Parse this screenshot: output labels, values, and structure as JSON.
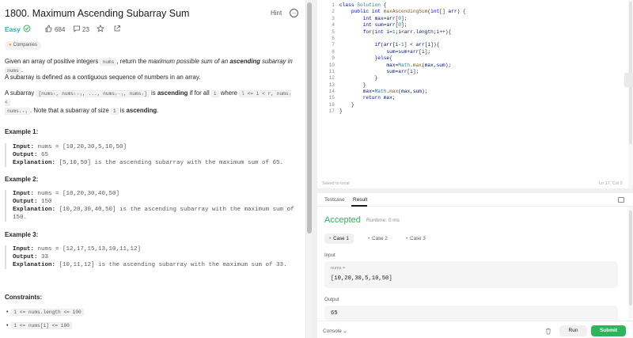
{
  "problem": {
    "title": "1800. Maximum Ascending Subarray Sum",
    "hint_label": "Hint",
    "difficulty": "Easy",
    "likes": "684",
    "comments": "23",
    "companies_label": "Companies",
    "desc1_a": "Given an array of positive integers ",
    "desc1_code": "nums",
    "desc1_b": ", return the ",
    "desc1_it": "maximum possible sum of an ",
    "desc1_bold": "ascending",
    "desc1_it2": " subarray in ",
    "desc1_code2": "nums",
    "desc1_c": ".",
    "desc2": "A subarray is defined as a contiguous sequence of numbers in an array.",
    "desc3_a": "A subarray ",
    "desc3_code1": "[numsₗ, numsₗ₊₁, ..., numsᵣ₋₁, numsᵣ]",
    "desc3_b": " is ",
    "desc3_bold": "ascending",
    "desc3_c": " if for all ",
    "desc3_code2": "i",
    "desc3_d": " where ",
    "desc3_code3": "l <= i < r, numsᵢ  <",
    "desc3_code4": "numsᵢ₊₁",
    "desc3_e": ". Note that a subarray of size ",
    "desc3_code5": "1",
    "desc3_f": " is ",
    "desc3_bold2": "ascending",
    "desc3_g": ".",
    "examples": [
      {
        "title": "Example 1:",
        "input_label": "Input:",
        "input": " nums = [10,20,30,5,10,50]",
        "output_label": "Output:",
        "output": " 65",
        "expl_label": "Explanation:",
        "expl": " [5,10,50] is the ascending subarray with the maximum sum of 65.",
        "expl2": ""
      },
      {
        "title": "Example 2:",
        "input_label": "Input:",
        "input": " nums = [10,20,30,40,50]",
        "output_label": "Output:",
        "output": " 150",
        "expl_label": "Explanation:",
        "expl": " [10,20,30,40,50] is the ascending subarray with the maximum sum of",
        "expl2": "150."
      },
      {
        "title": "Example 3:",
        "input_label": "Input:",
        "input": " nums = [12,17,15,13,10,11,12]",
        "output_label": "Output:",
        "output": " 33",
        "expl_label": "Explanation:",
        "expl": " [10,11,12] is the ascending subarray with the maximum sum of 33.",
        "expl2": ""
      }
    ],
    "constraints_title": "Constraints:",
    "constraints": [
      "1 <= nums.length <= 100",
      "1 <= nums[i] <= 100"
    ]
  },
  "editor": {
    "line_numbers": [
      "1",
      "2",
      "3",
      "4",
      "5",
      "6",
      "7",
      "8",
      "9",
      "10",
      "11",
      "12",
      "13",
      "14",
      "15",
      "16",
      "17"
    ],
    "status_left": "Saved to local",
    "status_right": "Ln 17, Col 2"
  },
  "result": {
    "tabs": [
      "Testcase",
      "Result"
    ],
    "active_tab": "Result",
    "verdict": "Accepted",
    "runtime": "Runtime: 0 ms",
    "cases": [
      "Case 1",
      "Case 2",
      "Case 3"
    ],
    "input_label": "Input",
    "input_sub": "nums =",
    "input_value": "[10,20,30,5,10,50]",
    "output_label": "Output",
    "output_value": "65",
    "console_label": "Console",
    "run_label": "Run",
    "submit_label": "Submit"
  },
  "colors": {
    "accent_green": "#2db55d",
    "easy_teal": "#1cb8b8",
    "keyword_blue": "#0000ff"
  }
}
